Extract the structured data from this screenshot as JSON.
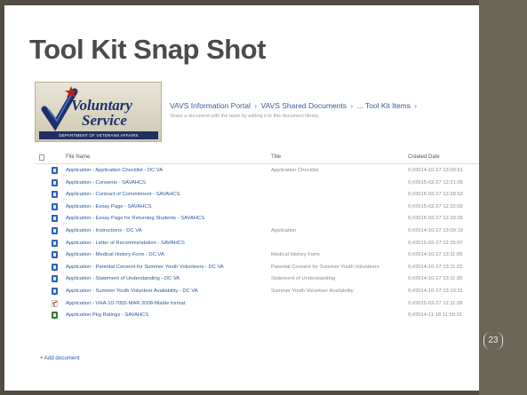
{
  "slide": {
    "title": "Tool Kit Snap Shot",
    "page_number": "23"
  },
  "logo": {
    "word1": "Voluntary",
    "word2": "Service",
    "department": "DEPARTMENT OF VETERANS AFFAIRS"
  },
  "breadcrumb": {
    "items": [
      "VAVS Information Portal",
      "VAVS Shared Documents",
      "... Tool Kit Items"
    ],
    "separator": "›"
  },
  "description": "Share a document with the team by adding it to this document library.",
  "table": {
    "headers": {
      "name": "File Name",
      "title": "Title",
      "date": "Created Date"
    },
    "rows": [
      {
        "icon": "word-doc-icon",
        "name": "Application - Application Checklist - DC VA",
        "title": "Application Checklist",
        "date": "0;#2014-10-27 13:09:51"
      },
      {
        "icon": "word-doc-icon",
        "name": "Application - Consents - SAVAHCS",
        "title": "",
        "date": "0;#2015-02-27 12:21:35"
      },
      {
        "icon": "word-doc-icon",
        "name": "Application - Contract of Commitment - SAVAHCS",
        "title": "",
        "date": "0;#2015-02-27 12:28:53"
      },
      {
        "icon": "word-doc-icon",
        "name": "Application - Essay Page - SAVAHCS",
        "title": "",
        "date": "0;#2015-02-27 12:32:02"
      },
      {
        "icon": "word-doc-icon",
        "name": "Application - Essay Page for Returning Students - SAVAHCS",
        "title": "",
        "date": "0;#2015-02-27 12:33:35"
      },
      {
        "icon": "word-doc-icon",
        "name": "Application - Instructions - DC VA",
        "title": "Application",
        "date": "0;#2014-10-27 13:09:19"
      },
      {
        "icon": "word-doc-icon",
        "name": "Application - Letter of Recommendation - SAVAHCS",
        "title": "",
        "date": "0;#2015-02-27 12:35:07"
      },
      {
        "icon": "word-doc-icon",
        "name": "Application - Medical History Form - DC VA",
        "title": "Medical History Form",
        "date": "0;#2014-10-27 13:11:05"
      },
      {
        "icon": "word-doc-icon",
        "name": "Application - Parental Consent for Summer Youth Volunteers - DC VA",
        "title": "Parental Consent for Summer Youth Volunteers",
        "date": "0;#2014-10-27 13:11:21"
      },
      {
        "icon": "word-doc-icon",
        "name": "Application - Statement of Understanding - DC VA",
        "title": "Statement of Understanding",
        "date": "0;#2014-10-27 13:11:35"
      },
      {
        "icon": "word-doc-icon",
        "name": "Application - Summer Youth Volunteer Availability - DC VA",
        "title": "Summer Youth Volunteer Availability",
        "date": "0;#2014-10-27 13:10:31"
      },
      {
        "icon": "pdf-icon",
        "name": "Application - VHA-10-7055-MAR 2008-fillable format",
        "title": "",
        "date": "0;#2015-02-27 12:11:39"
      },
      {
        "icon": "excel-icon",
        "name": "Application Pkg Ratings - SAVAHCS",
        "title": "",
        "date": "0;#2014-11-18 11:50:31"
      }
    ]
  },
  "add_document_label": "Add document",
  "colors": {
    "background": "#514d40",
    "accent_bar": "#6b6756",
    "link": "#2a5b99",
    "title_text": "#4b4b4b"
  }
}
